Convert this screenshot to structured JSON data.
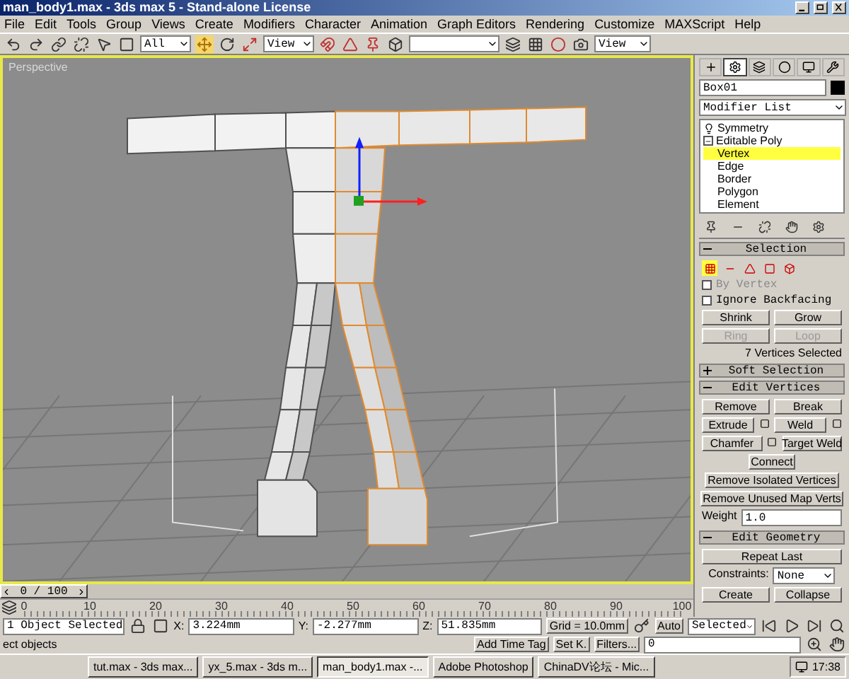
{
  "window": {
    "title": "man_body1.max - 3ds max 5 - Stand-alone License"
  },
  "menu": [
    "File",
    "Edit",
    "Tools",
    "Group",
    "Views",
    "Create",
    "Modifiers",
    "Character",
    "Animation",
    "Graph Editors",
    "Rendering",
    "Customize",
    "MAXScript",
    "Help"
  ],
  "toolbar": {
    "selection_filter": "All",
    "reference_coord": "View",
    "viewport_render": "View"
  },
  "viewport": {
    "label": "Perspective",
    "active": true
  },
  "command_panel": {
    "tabs": [
      {
        "kind": "create",
        "selected": false
      },
      {
        "kind": "modify",
        "selected": true
      },
      {
        "kind": "hierarchy",
        "selected": false
      },
      {
        "kind": "motion",
        "selected": false
      },
      {
        "kind": "display",
        "selected": false
      },
      {
        "kind": "utilities",
        "selected": false
      }
    ],
    "object_name": "Box01",
    "modifier_list": "Modifier List",
    "stack": [
      {
        "label": "Symmetry"
      },
      {
        "label": "Editable Poly",
        "expanded": true,
        "children": [
          {
            "label": "Vertex",
            "selected": true
          },
          {
            "label": "Edge",
            "selected": false
          },
          {
            "label": "Border",
            "selected": false
          },
          {
            "label": "Polygon",
            "selected": false
          },
          {
            "label": "Element",
            "selected": false
          }
        ]
      }
    ],
    "selection": {
      "title": "Selection",
      "expanded": true,
      "modes": [
        {
          "kind": "vertex",
          "selected": true
        },
        {
          "kind": "edge",
          "selected": false
        },
        {
          "kind": "border",
          "selected": false
        },
        {
          "kind": "polygon",
          "selected": false
        },
        {
          "kind": "element",
          "selected": false
        }
      ],
      "options": [
        {
          "label": "By Vertex",
          "checked": false,
          "disabled": true
        },
        {
          "label": "Ignore Backfacing",
          "checked": false,
          "disabled": false
        }
      ],
      "buttons": [
        {
          "label": "Shrink",
          "disabled": false
        },
        {
          "label": "Grow",
          "disabled": false
        },
        {
          "label": "Ring",
          "disabled": true
        },
        {
          "label": "Loop",
          "disabled": true
        }
      ],
      "status": "7 Vertices Selected"
    },
    "soft_selection": {
      "title": "Soft Selection",
      "expanded": false
    },
    "edit_vertices": {
      "title": "Edit Vertices",
      "expanded": true,
      "rows": [
        [
          {
            "label": "Remove",
            "settings": false
          },
          {
            "label": "Break",
            "settings": false
          }
        ],
        [
          {
            "label": "Extrude",
            "settings": true
          },
          {
            "label": "Weld",
            "settings": true
          }
        ],
        [
          {
            "label": "Chamfer",
            "settings": true
          },
          {
            "label": "Target Weld",
            "settings": false
          }
        ],
        [
          {
            "label": "Connect",
            "settings": false
          }
        ],
        [
          {
            "label": "Remove Isolated Vertices",
            "settings": false
          }
        ],
        [
          {
            "label": "Remove Unused Map Verts",
            "settings": false
          }
        ]
      ],
      "weight": {
        "label": "Weight",
        "value": "1.0"
      }
    },
    "edit_geometry": {
      "title": "Edit Geometry",
      "expanded": true,
      "repeat": "Repeat Last",
      "constraints_label": "Constraints:",
      "constraints_value": "None",
      "buttons": [
        "Create",
        "Collapse"
      ]
    }
  },
  "timeline": {
    "position": "0 / 100",
    "level": 0,
    "ticks": [
      "0",
      "10",
      "20",
      "30",
      "40",
      "50",
      "60",
      "70",
      "80",
      "90",
      "100"
    ]
  },
  "status_bar": {
    "selection": "1 Object Selected",
    "prompt": "ect objects",
    "coords": [
      {
        "axis": "X:",
        "value": "3.224mm"
      },
      {
        "axis": "Y:",
        "value": "-2.277mm"
      },
      {
        "axis": "Z:",
        "value": "51.835mm"
      }
    ],
    "grid": "Grid = 10.0mm",
    "time_tag": "Add Time Tag",
    "auto_key": "Auto",
    "key_filter": "Selected",
    "set_key": "Set K.",
    "filters": "Filters...",
    "frame": "0"
  },
  "taskbar": {
    "items": [
      {
        "label": "tut.max - 3ds max...",
        "selected": false
      },
      {
        "label": "yx_5.max - 3ds m...",
        "selected": false
      },
      {
        "label": "man_body1.max -...",
        "selected": true
      },
      {
        "label": "Adobe Photoshop",
        "selected": false
      },
      {
        "label": "ChinaDV论坛 - Mic...",
        "selected": false
      }
    ],
    "clock": "17:38"
  }
}
